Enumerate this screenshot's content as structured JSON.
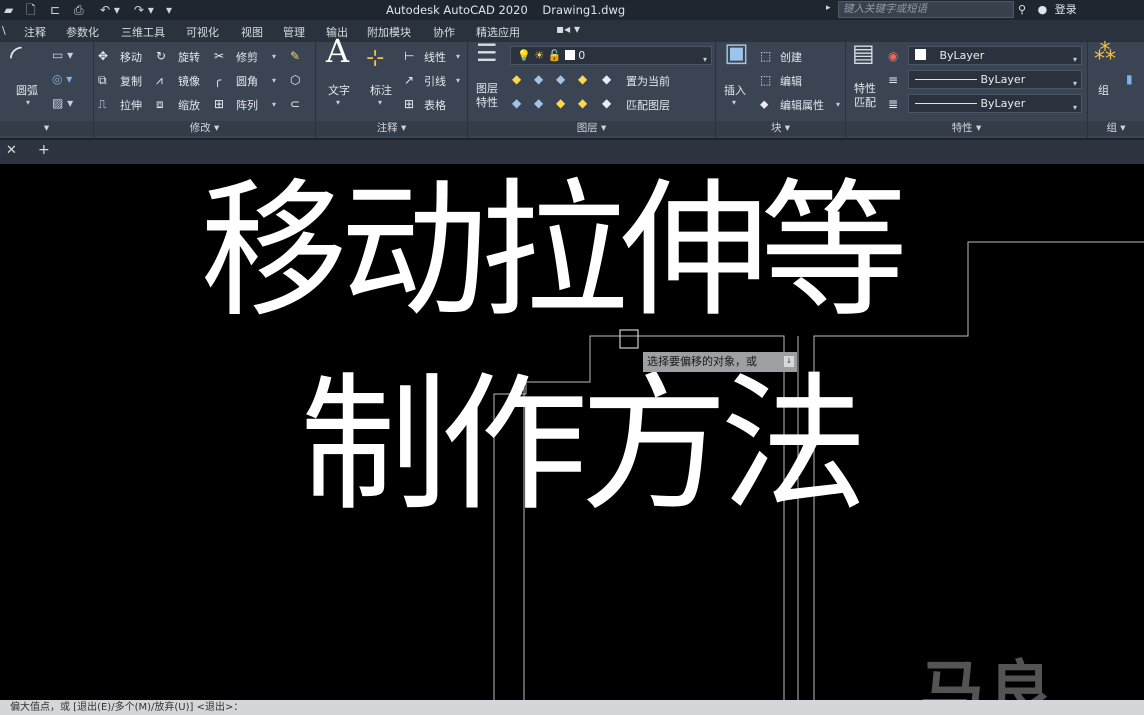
{
  "window": {
    "title": "Autodesk AutoCAD 2020    Drawing1.dwg",
    "search_placeholder": "键入关键字或短语",
    "login": "登录"
  },
  "menu_tabs": [
    "注释",
    "参数化",
    "三维工具",
    "可视化",
    "视图",
    "管理",
    "输出",
    "附加模块",
    "协作",
    "精选应用"
  ],
  "ribbon": {
    "draw_panel": {
      "arc": "圆弧"
    },
    "modify_panel": {
      "label": "修改",
      "move": "移动",
      "rotate": "旋转",
      "trim": "修剪",
      "copy": "复制",
      "mirror": "镜像",
      "fillet": "圆角",
      "stretch": "拉伸",
      "scale": "缩放",
      "array": "阵列"
    },
    "annotation_panel": {
      "label": "注释",
      "text": "文字",
      "dimension": "标注",
      "linear": "线性",
      "leader": "引线",
      "table": "表格"
    },
    "layers_panel": {
      "label": "图层",
      "layer_properties": "图层\n特性",
      "current_layer": "0",
      "make_current": "置为当前",
      "match_layer": "匹配图层"
    },
    "block_panel": {
      "label": "块",
      "insert": "插入",
      "create": "创建",
      "edit": "编辑",
      "edit_attributes": "编辑属性"
    },
    "properties_panel": {
      "label": "特性",
      "match_properties": "特性\n匹配",
      "color": "ByLayer",
      "linetype": "ByLayer",
      "lineweight": "ByLayer"
    },
    "groups_panel": {
      "label": "组",
      "group": "组"
    }
  },
  "overlay": {
    "line1": "移动拉伸等",
    "line2": "制作方法"
  },
  "tooltip": "选择要偏移的对象，或",
  "command_line": "偏大值点，或 [退出(E)/多个(M)/放弃(U)] <退出>：",
  "watermark": "马良"
}
